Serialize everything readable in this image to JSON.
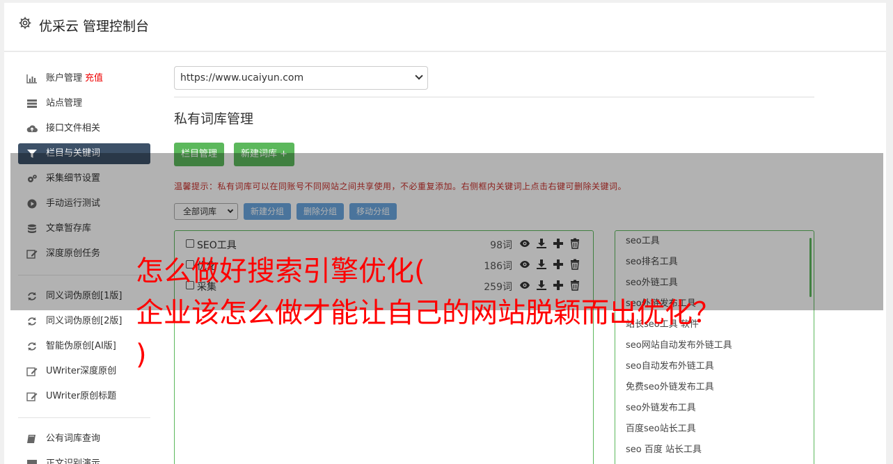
{
  "header": {
    "title": "优采云 管理控制台"
  },
  "sidebar": {
    "items": [
      {
        "label": "账户管理",
        "badge": "充值",
        "icon": "bar-chart-icon"
      },
      {
        "label": "站点管理",
        "icon": "server-icon"
      },
      {
        "label": "接口文件相关",
        "icon": "cloud-upload-icon"
      },
      {
        "label": "栏目与关键词",
        "icon": "filter-icon",
        "active": true
      },
      {
        "label": "采集细节设置",
        "icon": "cogs-icon"
      },
      {
        "label": "手动运行测试",
        "icon": "play-icon"
      },
      {
        "label": "文章暂存库",
        "icon": "database-icon"
      },
      {
        "label": "深度原创任务",
        "icon": "edit-icon"
      }
    ],
    "items2": [
      {
        "label": "同义词伪原创[1版]",
        "icon": "refresh-icon"
      },
      {
        "label": "同义词伪原创[2版]",
        "icon": "refresh-icon"
      },
      {
        "label": "智能伪原创[AI版]",
        "icon": "refresh-icon"
      },
      {
        "label": "UWriter深度原创",
        "icon": "edit-icon"
      },
      {
        "label": "UWriter原创标题",
        "icon": "edit-icon"
      }
    ],
    "items3": [
      {
        "label": "公有词库查询",
        "icon": "book-icon"
      },
      {
        "label": "正文识别演示",
        "icon": "monitor-icon"
      }
    ]
  },
  "main": {
    "site_select": "https://www.ucaiyun.com",
    "heading": "私有词库管理",
    "btn_column": "栏目管理",
    "btn_new_lib": "新建词库 +",
    "tip": "温馨提示：私有词库可以在同账号不同网站之间共享使用，不必重复添加。右侧框内关键词上点击右键可删除关键词。",
    "group_select": "全部词库",
    "btn_new_group": "新建分组",
    "btn_del_group": "删除分组",
    "btn_move_group": "移动分组",
    "libraries": [
      {
        "name": "SEO工具",
        "count": "98词"
      },
      {
        "name": "优化",
        "count": "186词"
      },
      {
        "name": "采集",
        "count": "259词"
      }
    ],
    "keywords": [
      "seo工具",
      "seo排名工具",
      "seo外链工具",
      "seo外链发布工具",
      "站长seo工具 软件",
      "seo网站自动发布外链工具",
      "seo自动发布外链工具",
      "免费seo外链发布工具",
      "seo外链发布工具",
      "百度seo站长工具",
      "seo 百度 站长工具"
    ]
  },
  "overlay_headline": {
    "line1": "怎么做好搜索引擎优化(",
    "line2": "企业该怎么做才能让自己的网站脱颖而出优化？",
    "line3": ")"
  },
  "colors": {
    "active_nav": "#3d5168",
    "green": "#5cb85c",
    "blue": "#6aa7e0",
    "headline": "#ff0000"
  }
}
